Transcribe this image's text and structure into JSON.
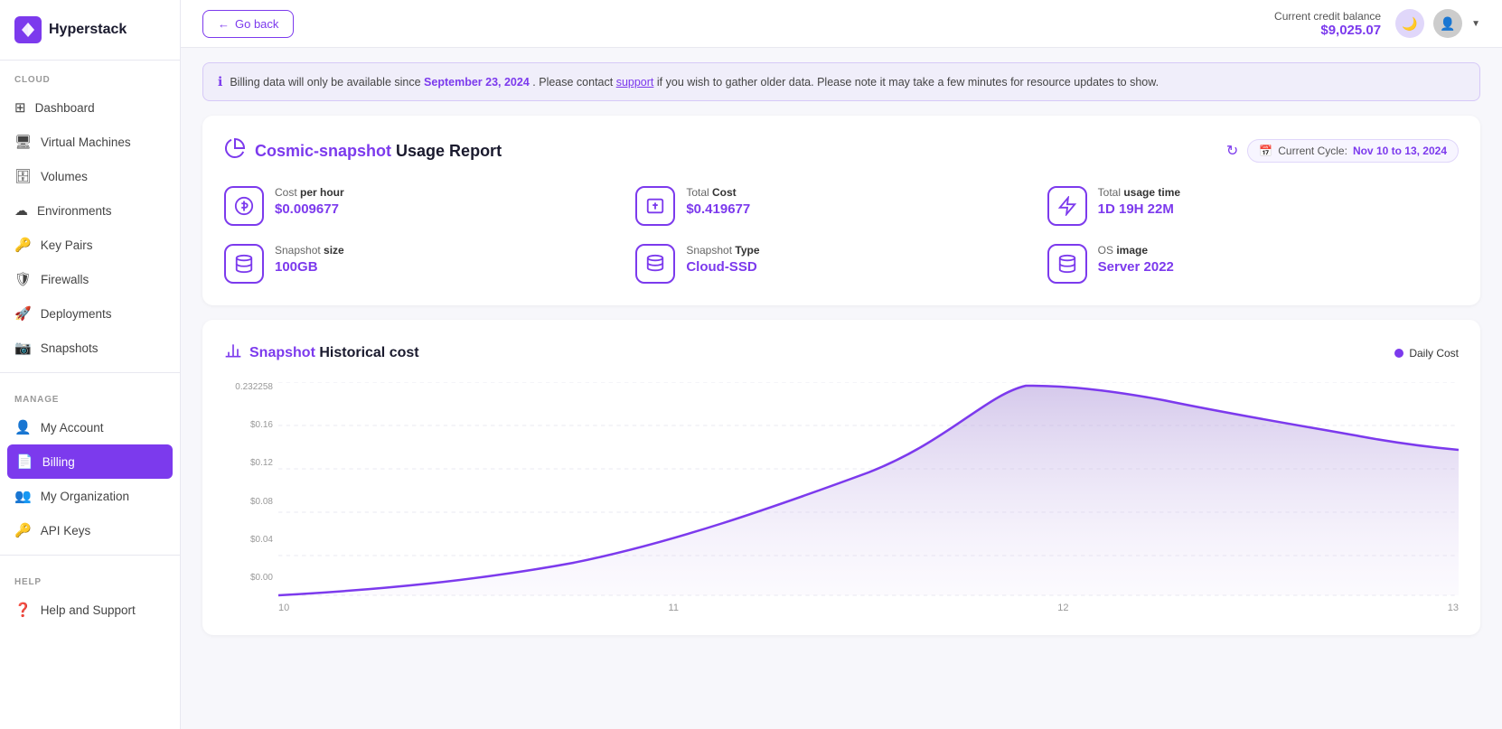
{
  "app": {
    "name": "Hyperstack"
  },
  "header": {
    "go_back_label": "Go back",
    "credit_label": "Current credit balance",
    "credit_amount": "$9,025.07"
  },
  "info_banner": {
    "text_before": "Billing data will only be available since ",
    "date": "September 23, 2024",
    "text_middle": ". Please contact ",
    "link_text": "support",
    "text_after": " if you wish to gather older data. Please note it may take a few minutes for resource updates to show."
  },
  "usage_report": {
    "title_prefix": "Cosmic-snapshot",
    "title_suffix": " Usage Report",
    "cycle_label": "Current Cycle:",
    "cycle_dates": "Nov 10 to 13, 2024",
    "stats": [
      {
        "label": "Cost",
        "label_bold": "per hour",
        "value": "$0.009677",
        "icon": "💲"
      },
      {
        "label": "Total",
        "label_bold": "Cost",
        "value": "$0.419677",
        "icon": "💵"
      },
      {
        "label": "Total",
        "label_bold": "usage time",
        "value": "1D 19H 22M",
        "icon": "⚡"
      },
      {
        "label": "Snapshot",
        "label_bold": "size",
        "value": "100GB",
        "icon": "📦"
      },
      {
        "label": "Snapshot",
        "label_bold": "Type",
        "value": "Cloud-SSD",
        "icon": "🗄️"
      },
      {
        "label": "OS",
        "label_bold": "image",
        "value": "Server 2022",
        "icon": "🖥️"
      }
    ]
  },
  "historical_cost": {
    "title_prefix": "Snapshot",
    "title_suffix": " Historical cost",
    "legend_label": "Daily Cost"
  },
  "chart": {
    "y_labels": [
      "0.232258",
      "$0.16",
      "$0.12",
      "$0.08",
      "$0.04",
      "$0.00"
    ],
    "x_labels": [
      "10",
      "11",
      "12",
      "13"
    ]
  },
  "sidebar": {
    "cloud_label": "CLOUD",
    "manage_label": "MANAGE",
    "help_label": "HELP",
    "items": [
      {
        "id": "dashboard",
        "label": "Dashboard",
        "icon": "⊞"
      },
      {
        "id": "virtual-machines",
        "label": "Virtual Machines",
        "icon": "🖥"
      },
      {
        "id": "volumes",
        "label": "Volumes",
        "icon": "🗄"
      },
      {
        "id": "environments",
        "label": "Environments",
        "icon": "☁"
      },
      {
        "id": "key-pairs",
        "label": "Key Pairs",
        "icon": "🔑"
      },
      {
        "id": "firewalls",
        "label": "Firewalls",
        "icon": "🛡"
      },
      {
        "id": "deployments",
        "label": "Deployments",
        "icon": "🚀"
      },
      {
        "id": "snapshots",
        "label": "Snapshots",
        "icon": "📷"
      },
      {
        "id": "my-account",
        "label": "My Account",
        "icon": "👤"
      },
      {
        "id": "billing",
        "label": "Billing",
        "icon": "📄",
        "active": true
      },
      {
        "id": "my-organization",
        "label": "My Organization",
        "icon": "👥"
      },
      {
        "id": "api-keys",
        "label": "API Keys",
        "icon": "🔑"
      },
      {
        "id": "help-and-support",
        "label": "Help and Support",
        "icon": "❓"
      }
    ]
  }
}
